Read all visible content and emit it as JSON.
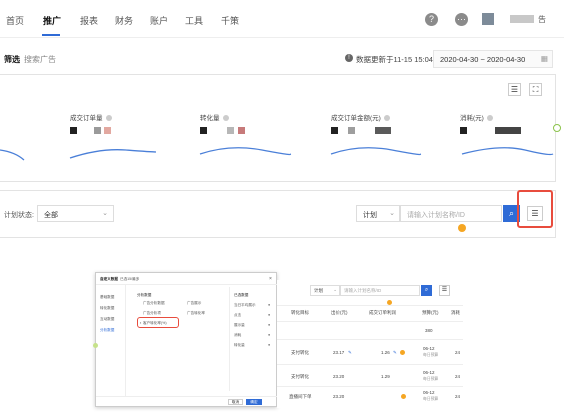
{
  "nav": {
    "items": [
      "首页",
      "推广",
      "报表",
      "财务",
      "账户",
      "工具",
      "千策"
    ],
    "active": "推广",
    "user_suffix": "告"
  },
  "subbar": {
    "tab_active": "筛选",
    "tab_other": "搜索广告",
    "update_text": "数据更新于11-15 15:04",
    "date_range": "2020-04-30 ~ 2020-04-30"
  },
  "metrics": [
    {
      "label": "成交订单量"
    },
    {
      "label": "转化量"
    },
    {
      "label": "成交订单金额(元)"
    },
    {
      "label": "消耗(元)"
    }
  ],
  "filter": {
    "status_label": "计划状态:",
    "status_value": "全部",
    "scope_value": "计划",
    "search_placeholder": "请输入计划名称/ID"
  },
  "dialog": {
    "title": "自定义数据",
    "subtitle": "已选15/最多",
    "left_items": [
      "基础数据",
      "转化数据",
      "互动数据",
      "分析数据"
    ],
    "col1_header": "分析数据",
    "col1_items": [
      "广告分析数据",
      "广告分析项",
      "客户转化率(%)"
    ],
    "col2_items": [
      "广告展示",
      "广告转化率"
    ],
    "col3_header": "已选数据",
    "col3_items": [
      "当日平均展示",
      "点击",
      "展示量",
      "消耗",
      "转化量"
    ],
    "cancel": "取消",
    "ok": "确定"
  },
  "table": {
    "scope_value": "计划",
    "search_placeholder": "请输入计划名称/ID",
    "headers": [
      "转化目标",
      "出价(元)",
      "成交订单利润",
      "预算(元)",
      "消耗"
    ],
    "total_budget": "380",
    "rows": [
      {
        "goal": "支付转化",
        "bid": "23.17",
        "ratio": "1.26",
        "budget": "06-12",
        "budget_sub": "每日预算",
        "cost": "24"
      },
      {
        "goal": "支付转化",
        "bid": "23.20",
        "ratio": "1.29",
        "budget": "06-12",
        "budget_sub": "每日预算",
        "cost": "24"
      },
      {
        "goal": "直播间下单",
        "bid": "23.20",
        "ratio": "",
        "budget": "06-12",
        "budget_sub": "每日预算",
        "cost": "24"
      }
    ]
  },
  "colors": {
    "accent": "#2f6bd6",
    "highlight": "#e84c3d",
    "badge": "#f5a623",
    "line": "#4a7fd8"
  },
  "icons": [
    "help-icon",
    "message-icon",
    "avatar",
    "calendar-icon",
    "filter-settings-icon",
    "fullscreen-icon",
    "search-icon",
    "chevron-down-icon",
    "edit-icon"
  ]
}
